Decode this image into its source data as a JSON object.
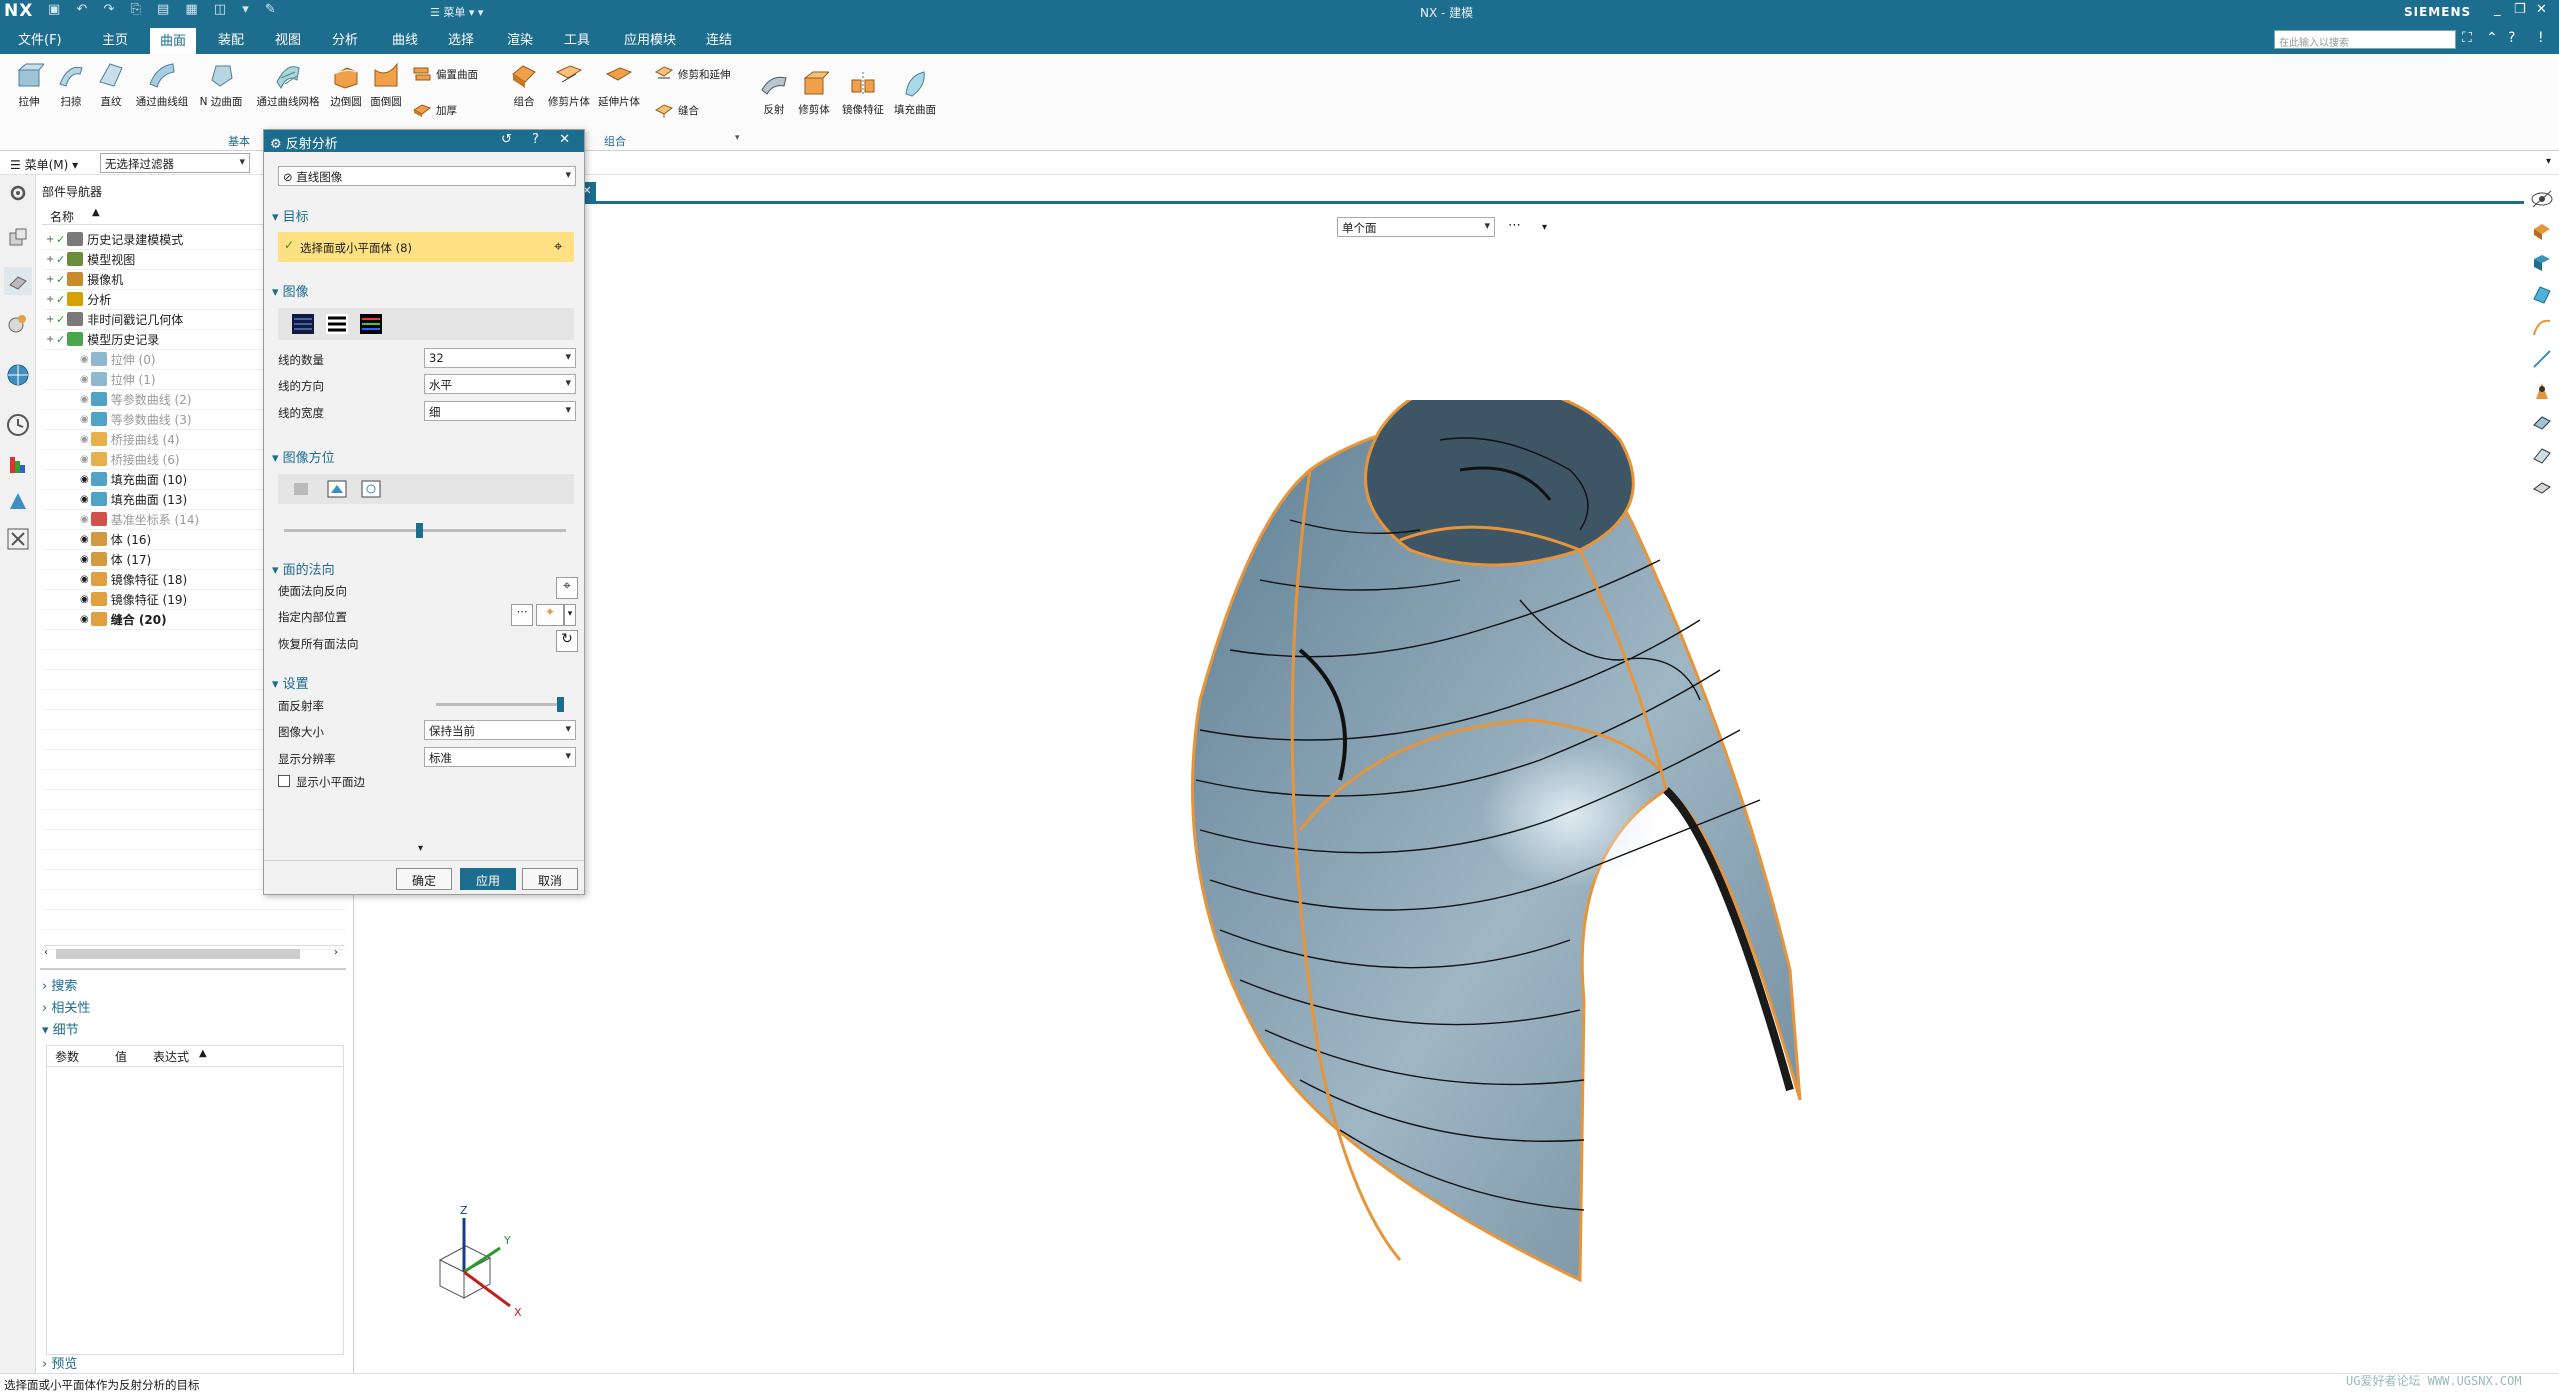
{
  "titlebar": {
    "logo": "NX",
    "quick_menu": "☰ 菜单 ▾ ▾",
    "window_title": "NX - 建模",
    "brand": "SIEMENS",
    "minimize": "_",
    "restore": "❐",
    "close": "✕"
  },
  "menubar": {
    "items": [
      "文件(F)",
      "主页",
      "曲面",
      "装配",
      "视图",
      "分析",
      "曲线",
      "选择",
      "渲染",
      "工具",
      "应用模块",
      "连结"
    ],
    "active_index": 2,
    "search_placeholder": "在此输入以搜索"
  },
  "ribbon": {
    "large_buttons": [
      {
        "label": "拉伸",
        "icon": "extrude-icon"
      },
      {
        "label": "扫掠",
        "icon": "sweep-icon"
      },
      {
        "label": "直纹",
        "icon": "ruled-icon"
      },
      {
        "label": "通过曲线组",
        "icon": "through-curves-icon"
      },
      {
        "label": "N 边曲面",
        "icon": "n-sided-surface-icon"
      },
      {
        "label": "通过曲线网格",
        "icon": "curve-mesh-icon"
      },
      {
        "label": "边倒圆",
        "icon": "edge-blend-icon"
      },
      {
        "label": "面倒圆",
        "icon": "face-blend-icon"
      }
    ],
    "small_buttons_1": [
      {
        "label": "偏置曲面",
        "icon": "offset-surface-icon"
      },
      {
        "label": "加厚",
        "icon": "thicken-icon"
      }
    ],
    "group2_large": [
      {
        "label": "组合",
        "icon": "combine-icon"
      },
      {
        "label": "修剪片体",
        "icon": "trim-sheet-icon"
      },
      {
        "label": "延伸片体",
        "icon": "extend-sheet-icon"
      }
    ],
    "small_buttons_2": [
      {
        "label": "修剪和延伸",
        "icon": "trim-extend-icon"
      },
      {
        "label": "缝合",
        "icon": "sew-icon"
      }
    ],
    "group3_large": [
      {
        "label": "反射",
        "icon": "reflect-icon"
      },
      {
        "label": "修剪体",
        "icon": "trim-body-icon"
      },
      {
        "label": "镜像特征",
        "icon": "mirror-feature-icon"
      },
      {
        "label": "填充曲面",
        "icon": "fill-surface-icon"
      }
    ],
    "group_labels": [
      "基本",
      "组合"
    ]
  },
  "filterbar": {
    "menu_label": "☰ 菜单(M) ▾",
    "filter_value": "无选择过滤器"
  },
  "navigator": {
    "title": "部件导航器",
    "column_name": "名称",
    "rows": [
      {
        "label": "历史记录建模模式",
        "indent": 1,
        "style": "normal",
        "color": "#7a7a7a"
      },
      {
        "label": "模型视图",
        "indent": 1,
        "style": "normal",
        "color": "#6b8e3d"
      },
      {
        "label": "摄像机",
        "indent": 1,
        "style": "normal",
        "color": "#c88a2c"
      },
      {
        "label": "分析",
        "indent": 1,
        "style": "normal",
        "color": "#d6a000"
      },
      {
        "label": "非时间戳记几何体",
        "indent": 1,
        "style": "normal",
        "color": "#7a7a7a"
      },
      {
        "label": "模型历史记录",
        "indent": 1,
        "style": "normal",
        "color": "#4aa64a"
      },
      {
        "label": "拉伸 (0)",
        "indent": 3,
        "style": "grey",
        "color": "#8db8cf"
      },
      {
        "label": "拉伸 (1)",
        "indent": 3,
        "style": "grey",
        "color": "#8db8cf"
      },
      {
        "label": "等参数曲线 (2)",
        "indent": 3,
        "style": "grey",
        "color": "#4fa3c7"
      },
      {
        "label": "等参数曲线 (3)",
        "indent": 3,
        "style": "grey",
        "color": "#4fa3c7"
      },
      {
        "label": "桥接曲线 (4)",
        "indent": 3,
        "style": "grey",
        "color": "#e8b04a"
      },
      {
        "label": "桥接曲线 (6)",
        "indent": 3,
        "style": "grey",
        "color": "#e8b04a"
      },
      {
        "label": "填充曲面 (10)",
        "indent": 3,
        "style": "normal",
        "color": "#4fa3c7"
      },
      {
        "label": "填充曲面 (13)",
        "indent": 3,
        "style": "normal",
        "color": "#4fa3c7"
      },
      {
        "label": "基准坐标系 (14)",
        "indent": 3,
        "style": "grey",
        "color": "#d0504a"
      },
      {
        "label": "体 (16)",
        "indent": 3,
        "style": "normal",
        "color": "#d49a40"
      },
      {
        "label": "体 (17)",
        "indent": 3,
        "style": "normal",
        "color": "#d49a40"
      },
      {
        "label": "镜像特征 (18)",
        "indent": 3,
        "style": "normal",
        "color": "#e0a040"
      },
      {
        "label": "镜像特征 (19)",
        "indent": 3,
        "style": "normal",
        "color": "#e0a040"
      },
      {
        "label": "缝合 (20)",
        "indent": 3,
        "style": "bold",
        "color": "#e0a040"
      }
    ],
    "sections": [
      "搜索",
      "相关性",
      "细节",
      "预览"
    ],
    "detail_columns": [
      "参数",
      "值",
      "表达式"
    ]
  },
  "dialog": {
    "title": "反射分析",
    "header_controls": "↺ ? ✕",
    "type_value": "直线图像",
    "sec_target": "目标",
    "select_label": "选择面或小平面体 (8)",
    "sec_image": "图像",
    "num_lines_label": "线的数量",
    "num_lines_value": "32",
    "line_dir_label": "线的方向",
    "line_dir_value": "水平",
    "line_width_label": "线的宽度",
    "line_width_value": "细",
    "sec_orient": "图像方位",
    "orient_slider_pct": 0.48,
    "sec_normal": "面的法向",
    "flip_normal_label": "使面法向反向",
    "inner_pos_label": "指定内部位置",
    "restore_label": "恢复所有面法向",
    "sec_settings": "设置",
    "reflectivity_label": "面反射率",
    "reflectivity_pct": 1.0,
    "image_size_label": "图像大小",
    "image_size_value": "保持当前",
    "resolution_label": "显示分辨率",
    "resolution_value": "标准",
    "show_facet_label": "显示小平面边",
    "ok": "确定",
    "apply": "应用",
    "cancel": "取消"
  },
  "viewport": {
    "select_filter": "单个面",
    "more": "⋯",
    "axes": [
      "Z",
      "Y",
      "X"
    ]
  },
  "statusbar": {
    "prompt": "选择面或小平面体作为反射分析的目标"
  },
  "watermark": "UG爱好者论坛 WWW.UGSNX.COM",
  "colors": {
    "brand": "#1d6d8f",
    "surface": "#7d9cb0",
    "edge": "#e8953a",
    "highlight": "#ffe082"
  }
}
